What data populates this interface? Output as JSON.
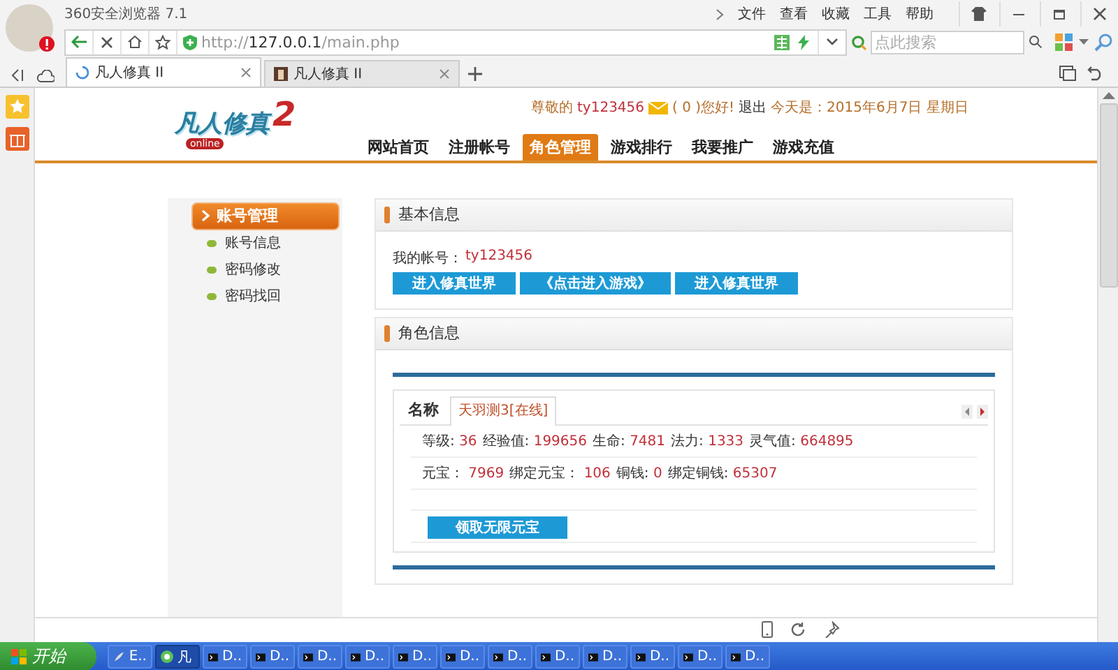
{
  "browser": {
    "title": "360安全浏览器 7.1",
    "menu": [
      "文件",
      "查看",
      "收藏",
      "工具",
      "帮助"
    ],
    "address": {
      "scheme": "http://",
      "host": "127.0.0.1",
      "path": "/main.php"
    },
    "search": {
      "placeholder": "点此搜索"
    },
    "tabs": [
      {
        "label": "凡人修真 II",
        "selected": true,
        "loading": true
      },
      {
        "label": "凡人修真 II",
        "selected": false,
        "loading": false
      }
    ]
  },
  "site": {
    "logo": {
      "title": "凡人修真",
      "tag": "online",
      "number": "2"
    },
    "greeting": "尊敬的",
    "username": "ty123456",
    "mail": "( 0 )您好!",
    "logout": "退出",
    "date": "今天是：2015年6月7日 星期日",
    "nav": [
      {
        "label": "网站首页",
        "selected": false
      },
      {
        "label": "注册帐号",
        "selected": false
      },
      {
        "label": "角色管理",
        "selected": true
      },
      {
        "label": "游戏排行",
        "selected": false
      },
      {
        "label": "我要推广",
        "selected": false
      },
      {
        "label": "游戏充值",
        "selected": false
      }
    ]
  },
  "sidebar": {
    "heading": "账号管理",
    "items": [
      "账号信息",
      "密码修改",
      "密码找回"
    ]
  },
  "basic_info": {
    "title": "基本信息",
    "account_label": "我的帐号：",
    "account": "ty123456",
    "buttons": [
      "进入修真世界",
      "《点击进入游戏》",
      "进入修真世界"
    ]
  },
  "role_info": {
    "title": "角色信息",
    "name_label": "名称",
    "characters": [
      {
        "label": "天羽测3[在线]",
        "selected": true
      }
    ],
    "stats": [
      [
        {
          "label": "等级:",
          "value": "36"
        },
        {
          "label": "经验值:",
          "value": "199656"
        },
        {
          "label": "生命:",
          "value": "7481"
        },
        {
          "label": "法力:",
          "value": "1333"
        },
        {
          "label": "灵气值:",
          "value": "664895"
        }
      ],
      [
        {
          "label": "元宝：",
          "value": "7969"
        },
        {
          "label": "绑定元宝：",
          "value": "106"
        },
        {
          "label": "铜钱:",
          "value": "0"
        },
        {
          "label": "绑定铜钱:",
          "value": "65307"
        }
      ]
    ],
    "button": "领取无限元宝"
  },
  "taskbar": {
    "start": "开始",
    "tasks": [
      {
        "label": "E..",
        "kind": "browser",
        "selected": false
      },
      {
        "label": "凡",
        "kind": "app",
        "selected": true
      },
      {
        "label": "D..",
        "kind": "console",
        "selected": false
      },
      {
        "label": "D..",
        "kind": "console",
        "selected": false
      },
      {
        "label": "D..",
        "kind": "console",
        "selected": false
      },
      {
        "label": "D..",
        "kind": "console",
        "selected": false
      },
      {
        "label": "D..",
        "kind": "console",
        "selected": false
      },
      {
        "label": "D..",
        "kind": "console",
        "selected": false
      },
      {
        "label": "D..",
        "kind": "console",
        "selected": false
      },
      {
        "label": "D..",
        "kind": "console",
        "selected": false
      },
      {
        "label": "D..",
        "kind": "console",
        "selected": false
      },
      {
        "label": "D..",
        "kind": "console",
        "selected": false
      },
      {
        "label": "D..",
        "kind": "console",
        "selected": false
      },
      {
        "label": "D..",
        "kind": "console",
        "selected": false
      }
    ]
  }
}
